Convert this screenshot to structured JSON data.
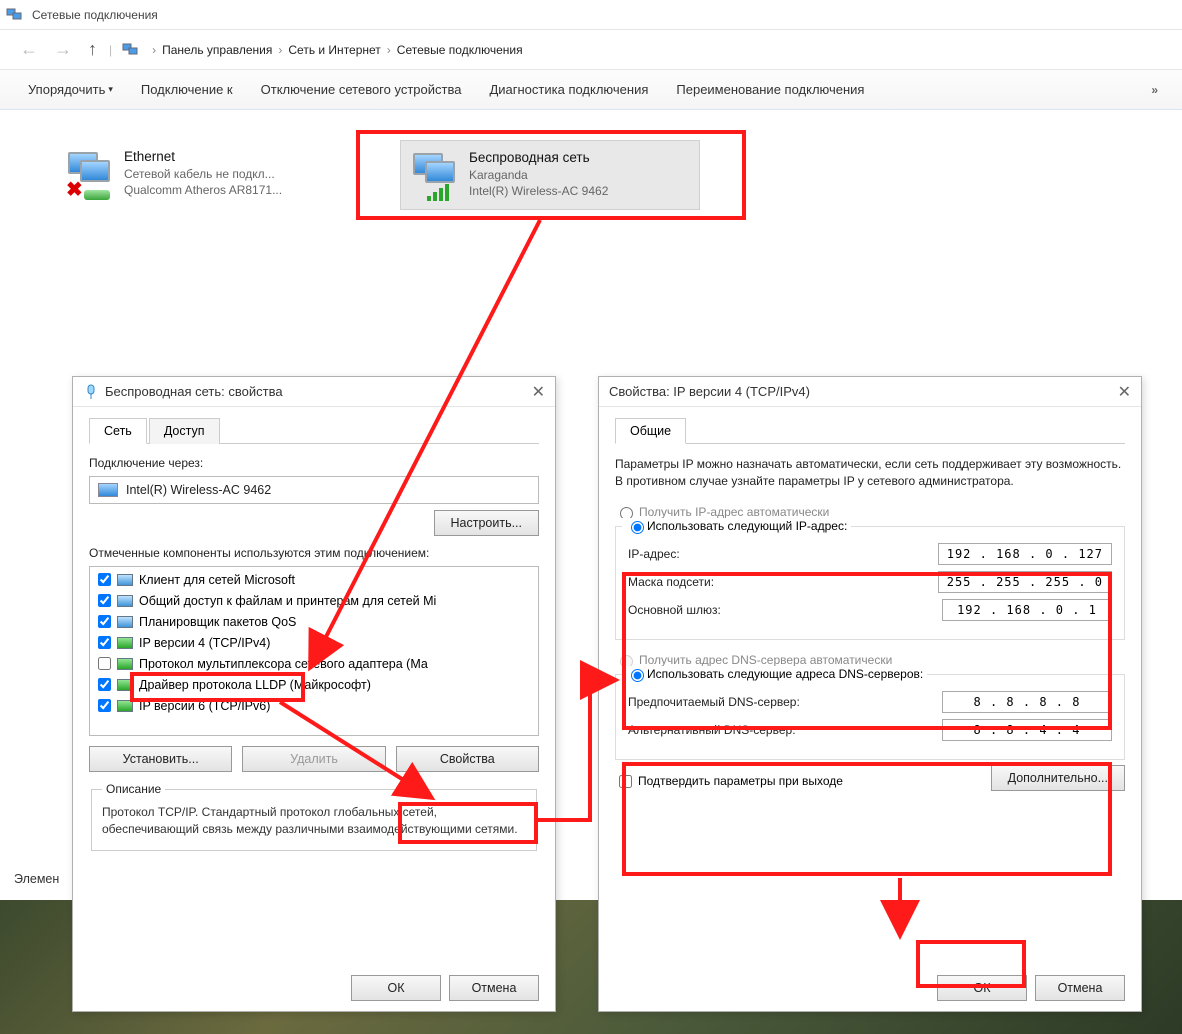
{
  "window": {
    "title": "Сетевые подключения"
  },
  "breadcrumb": {
    "item1": "Панель управления",
    "item2": "Сеть и Интернет",
    "item3": "Сетевые подключения"
  },
  "toolbar": {
    "organize": "Упорядочить",
    "connect": "Подключение к",
    "disable": "Отключение сетевого устройства",
    "diagnose": "Диагностика подключения",
    "rename": "Переименование подключения",
    "more": "»"
  },
  "connections": {
    "ethernet": {
      "name": "Ethernet",
      "status": "Сетевой кабель не подкл...",
      "adapter": "Qualcomm Atheros AR8171..."
    },
    "wifi": {
      "name": "Беспроводная сеть",
      "status": "Karaganda",
      "adapter": "Intel(R) Wireless-AC 9462"
    }
  },
  "dlg1": {
    "title": "Беспроводная сеть: свойства",
    "tabs": {
      "net": "Сеть",
      "access": "Доступ"
    },
    "conn_label": "Подключение через:",
    "adapter": "Intel(R) Wireless-AC 9462",
    "configure": "Настроить...",
    "comp_label": "Отмеченные компоненты используются этим подключением:",
    "components": [
      "Клиент для сетей Microsoft",
      "Общий доступ к файлам и принтерам для сетей Mi",
      "Планировщик пакетов QoS",
      "IP версии 4 (TCP/IPv4)",
      "Протокол мультиплексора сетевого адаптера (Ма",
      "Драйвер протокола LLDP (Майкрософт)",
      "IP версии 6 (TCP/IPv6)"
    ],
    "install": "Установить...",
    "remove": "Удалить",
    "properties": "Свойства",
    "desc_legend": "Описание",
    "desc_text": "Протокол TCP/IP. Стандартный протокол глобальных сетей, обеспечивающий связь между различными взаимодействующими сетями.",
    "ok": "ОК",
    "cancel": "Отмена"
  },
  "dlg2": {
    "title": "Свойства: IP версии 4 (TCP/IPv4)",
    "tab_general": "Общие",
    "help_text": "Параметры IP можно назначать автоматически, если сеть поддерживает эту возможность. В противном случае узнайте параметры IP у сетевого администратора.",
    "radio_ip_auto": "Получить IP-адрес автоматически",
    "radio_ip_manual": "Использовать следующий IP-адрес:",
    "ip_label": "IP-адрес:",
    "ip_value": "192 . 168 .  0  . 127",
    "mask_label": "Маска подсети:",
    "mask_value": "255 . 255 . 255 .  0",
    "gateway_label": "Основной шлюз:",
    "gateway_value": "192 . 168 .  0  .  1",
    "radio_dns_auto": "Получить адрес DNS-сервера автоматически",
    "radio_dns_manual": "Использовать следующие адреса DNS-серверов:",
    "dns1_label": "Предпочитаемый DNS-сервер:",
    "dns1_value": "8  .  8  .  8  .  8",
    "dns2_label": "Альтернативный DNS-сервер:",
    "dns2_value": "8  .  8  .  4  .  4",
    "confirm_exit": "Подтвердить параметры при выходе",
    "advanced": "Дополнительно...",
    "ok": "ОК",
    "cancel": "Отмена"
  },
  "side_label": "Элемен"
}
